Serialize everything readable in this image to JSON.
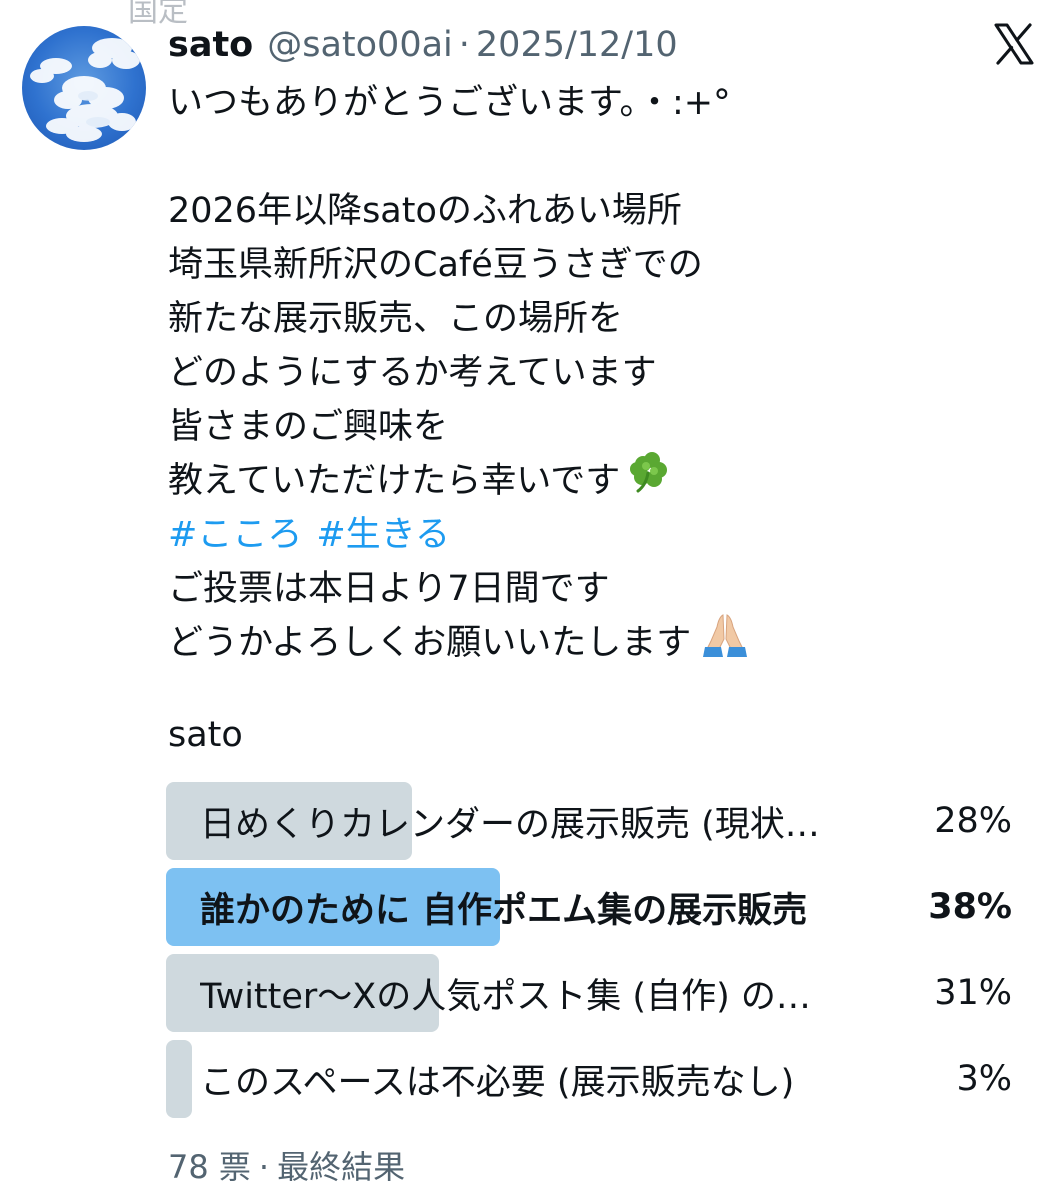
{
  "top_fragment": "国定",
  "author": {
    "name": "sato",
    "handle": "@sato00ai",
    "separator": "·",
    "date": "2025/12/10",
    "avatar_icon": "sky-clouds-avatar"
  },
  "platform_icon": "x-logo-icon",
  "post": {
    "line1": "いつもありがとうございます。・:+°",
    "line2": "2026年以降satoのふれあい場所",
    "line3": "埼玉県新所沢のCafé豆うさぎでの",
    "line4": "新たな展示販売、この場所を",
    "line5": "どのようにするか考えています",
    "line6": "皆さまのご興味を",
    "line7": "教えていただけたら幸いです",
    "line7_emoji": "four-leaf-clover-icon",
    "hashtags": [
      "#こころ",
      "#生きる"
    ],
    "line8": "ご投票は本日より7日間です",
    "line9": "どうかよろしくお願いいたします",
    "line9_emoji": "folded-hands-icon"
  },
  "poll": {
    "title": "sato",
    "options": [
      {
        "label": "日めくりカレンダーの展示販売 (現状…",
        "percent_text": "28%",
        "percent": 28,
        "winner": false
      },
      {
        "label": "誰かのために 自作ポエム集の展示販売",
        "percent_text": "38%",
        "percent": 38,
        "winner": true
      },
      {
        "label": "Twitter～Xの人気ポスト集 (自作) の…",
        "percent_text": "31%",
        "percent": 31,
        "winner": false
      },
      {
        "label": "このスペースは不必要 (展示販売なし)",
        "percent_text": "3%",
        "percent": 3,
        "winner": false
      }
    ],
    "votes": "78 票",
    "separator": "·",
    "status": "最終結果"
  },
  "colors": {
    "text": "#0f1419",
    "muted": "#536471",
    "link": "#1d9bf0",
    "bar": "#cfd9de",
    "winner_bar": "#7dc1f2"
  }
}
